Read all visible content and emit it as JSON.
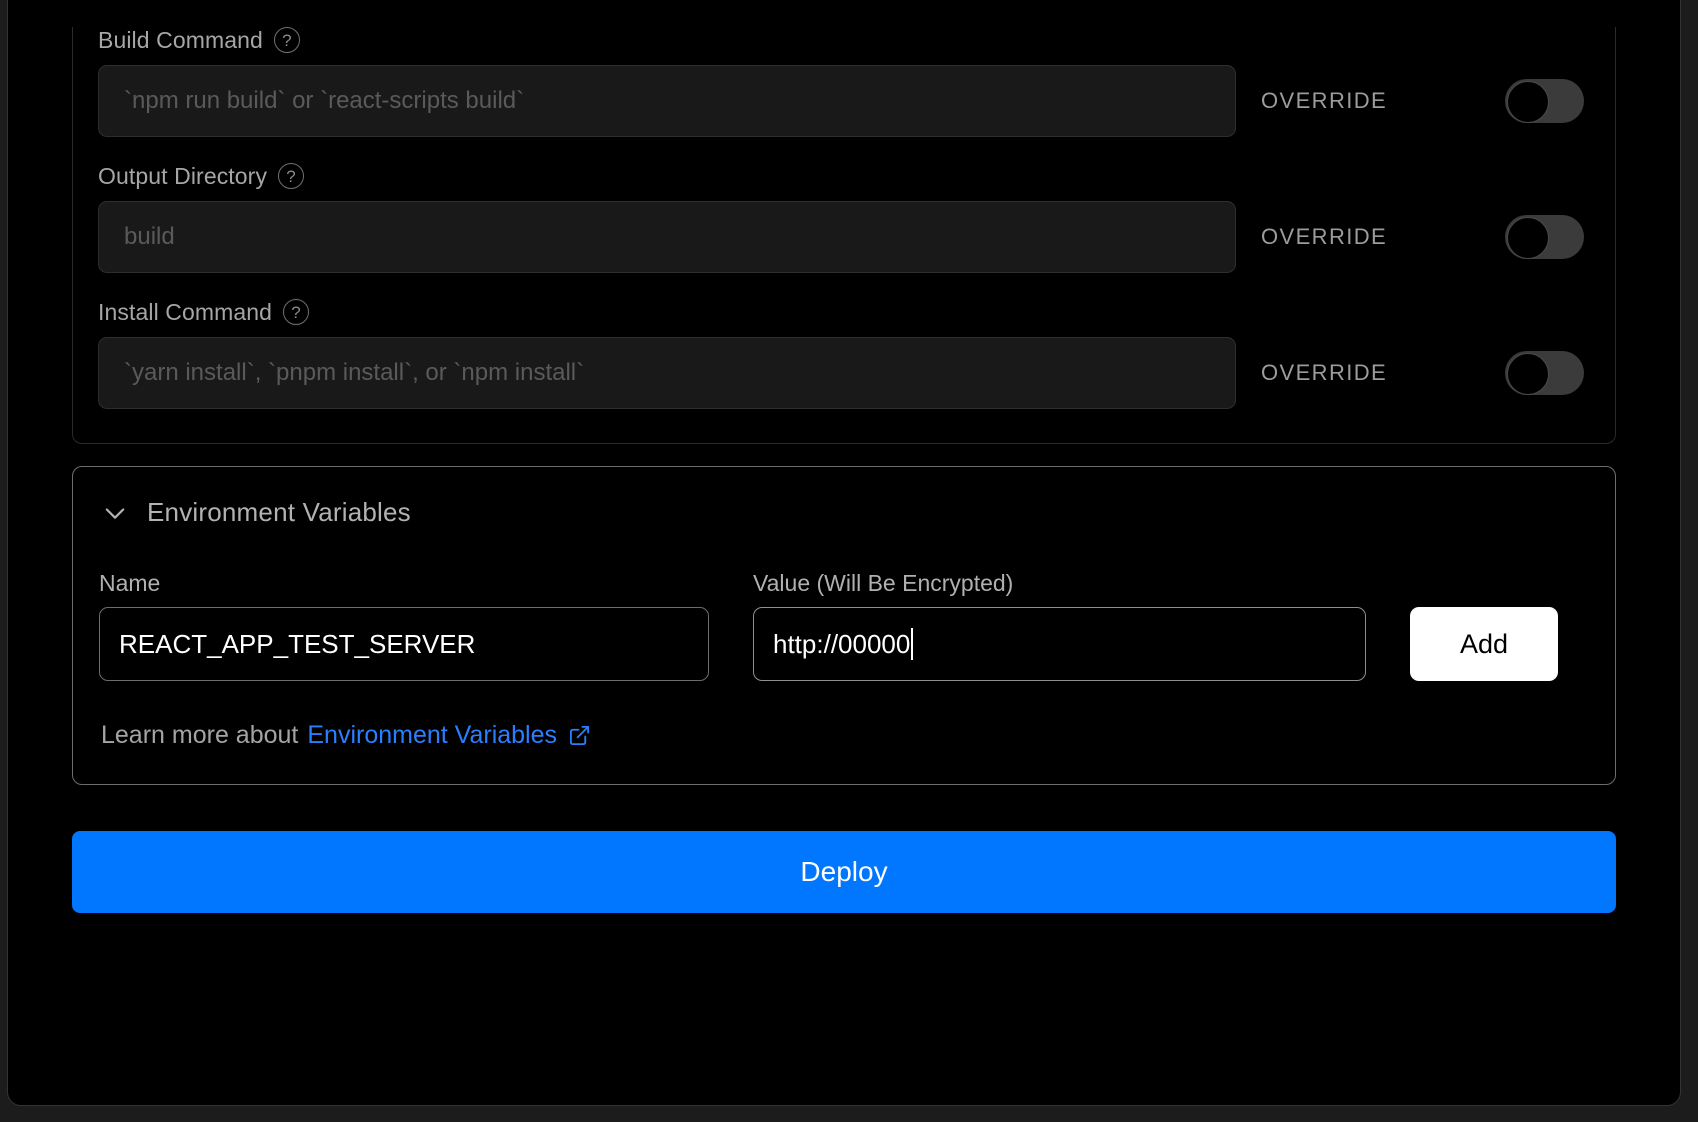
{
  "build_settings": {
    "fields": [
      {
        "label": "Build Command",
        "help_icon": "help-circle-icon",
        "placeholder": "`npm run build` or `react-scripts build`",
        "value": "",
        "override_label": "OVERRIDE",
        "override_on": false
      },
      {
        "label": "Output Directory",
        "help_icon": "help-circle-icon",
        "placeholder": "build",
        "value": "",
        "override_label": "OVERRIDE",
        "override_on": false
      },
      {
        "label": "Install Command",
        "help_icon": "help-circle-icon",
        "placeholder": "`yarn install`, `pnpm install`, or `npm install`",
        "value": "",
        "override_label": "OVERRIDE",
        "override_on": false
      }
    ]
  },
  "environment_variables": {
    "section_title": "Environment Variables",
    "chevron_icon": "chevron-down-icon",
    "expanded": true,
    "name_label": "Name",
    "name_value": "REACT_APP_TEST_SERVER",
    "value_label": "Value (Will Be Encrypted)",
    "value_value": "http://00000",
    "add_label": "Add",
    "learn_more_prefix": "Learn more about",
    "learn_more_link": "Environment Variables",
    "external_link_icon": "external-link-icon"
  },
  "deploy": {
    "label": "Deploy"
  },
  "colors": {
    "page_background": "#1c1c1c",
    "dialog_background": "#000000",
    "accent_blue": "#0176ff",
    "link_blue": "#2a7fff",
    "panel_border_dim": "#2b2b2b",
    "panel_border_bright": "#6d6d6d",
    "input_background": "#191919",
    "toggle_track": "#3b3b3b",
    "add_button_background": "#ffffff",
    "label_text": "#a6a6a6",
    "value_text": "#ffffff"
  }
}
